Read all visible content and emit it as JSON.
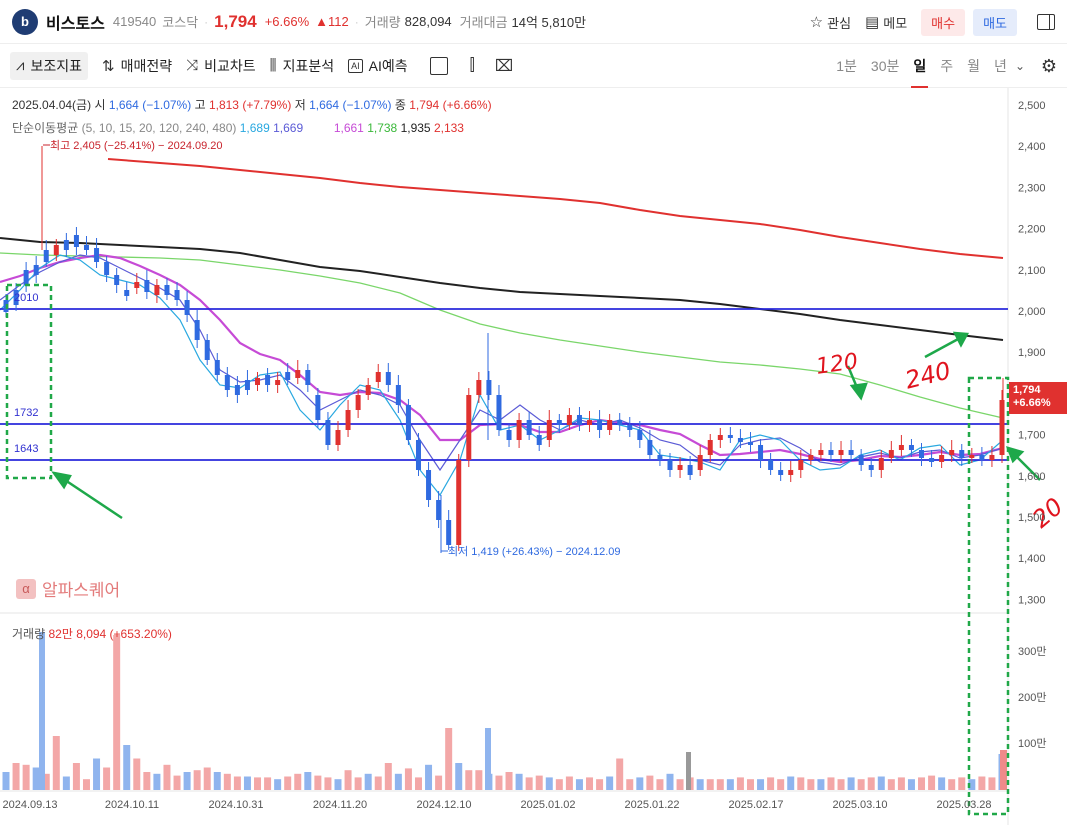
{
  "header": {
    "logo_letter": "b",
    "name": "비스토스",
    "code": "419540",
    "market": "코스닥",
    "price": "1,794",
    "change_pct": "+6.66%",
    "change_abs": "▲112",
    "volume_label": "거래량",
    "volume": "828,094",
    "amount_label": "거래대금",
    "amount": "14억 5,810만",
    "watch_label": "관심",
    "memo_label": "메모",
    "buy_label": "매수",
    "sell_label": "매도"
  },
  "toolbar": {
    "indicators_label": "보조지표",
    "strategy_label": "매매전략",
    "compare_label": "비교차트",
    "analysis_label": "지표분석",
    "ai_label": "AI예측",
    "ai_icon_text": "AI",
    "periods": [
      "1분",
      "30분",
      "일",
      "주",
      "월",
      "년"
    ],
    "active_period": "일"
  },
  "ohlc_info": {
    "date": "2025.04.04(금)",
    "open_label": "시",
    "open": "1,664 (−1.07%)",
    "high_label": "고",
    "high": "1,813 (+7.79%)",
    "low_label": "저",
    "low": "1,664 (−1.07%)",
    "close_label": "종",
    "close": "1,794 (+6.66%)"
  },
  "ma_info": {
    "label": "단순이동평균",
    "periods": "(5, 10, 15, 20, 120, 240, 480)",
    "values": [
      "1,689",
      "1,669",
      "",
      "1,661",
      "1,738",
      "1,935",
      "2,133"
    ],
    "colors": [
      "#29a8e0",
      "#5b5bd6",
      "#cccccc",
      "#c64bd6",
      "#3ab83a",
      "#222222",
      "#e0312f"
    ]
  },
  "annotations": {
    "max_label": "최고 2,405 (−25.41%) − 2024.09.20",
    "min_label": "최저 1,419 (+26.43%) − 2024.12.09",
    "line_2010": "2010",
    "line_1732": "1732",
    "line_1643": "1643",
    "hand_120": "120",
    "hand_240": "240",
    "hand_20": "20"
  },
  "brand": {
    "icon": "α",
    "name": "알파스퀘어"
  },
  "volume_info": {
    "label": "거래량",
    "value": "82만 8,094 (+653.20%)"
  },
  "price_tag": {
    "price": "1,794",
    "pct": "+6.66%"
  },
  "chart_data": {
    "type": "candlestick",
    "y_ticks": [
      "2,500",
      "2,400",
      "2,300",
      "2,200",
      "2,100",
      "2,000",
      "1,900",
      "1,800",
      "1,700",
      "1,600",
      "1,500",
      "1,400",
      "1,300"
    ],
    "vol_ticks": [
      "300만",
      "200만",
      "100만"
    ],
    "x_ticks": [
      "2024.09.13",
      "2024.10.11",
      "2024.10.31",
      "2024.11.20",
      "2024.12.10",
      "2025.01.02",
      "2025.01.22",
      "2025.02.17",
      "2025.03.10",
      "2025.03.28"
    ],
    "horizontal_lines": [
      2010,
      1732,
      1643
    ],
    "ylim": [
      1250,
      2530
    ],
    "ma_120": [
      [
        24,
        2187
      ],
      [
        42,
        2182
      ],
      [
        60,
        2178
      ],
      [
        80,
        2170
      ],
      [
        100,
        2162
      ],
      [
        120,
        2155
      ],
      [
        160,
        2140
      ],
      [
        200,
        2125
      ],
      [
        240,
        2112
      ],
      [
        280,
        2100
      ],
      [
        320,
        2088
      ],
      [
        340,
        2080
      ],
      [
        360,
        2070
      ],
      [
        380,
        2062
      ],
      [
        400,
        2050
      ],
      [
        420,
        2035
      ],
      [
        440,
        2020
      ],
      [
        460,
        2008
      ],
      [
        480,
        1998
      ],
      [
        500,
        1988
      ],
      [
        520,
        1978
      ],
      [
        560,
        1962
      ],
      [
        600,
        1947
      ],
      [
        640,
        1932
      ],
      [
        680,
        1918
      ],
      [
        720,
        1904
      ],
      [
        760,
        1890
      ],
      [
        800,
        1878
      ],
      [
        840,
        1866
      ],
      [
        880,
        1853
      ],
      [
        920,
        1840
      ],
      [
        960,
        1827
      ],
      [
        980,
        1818
      ],
      [
        1000,
        1812
      ]
    ]
  }
}
